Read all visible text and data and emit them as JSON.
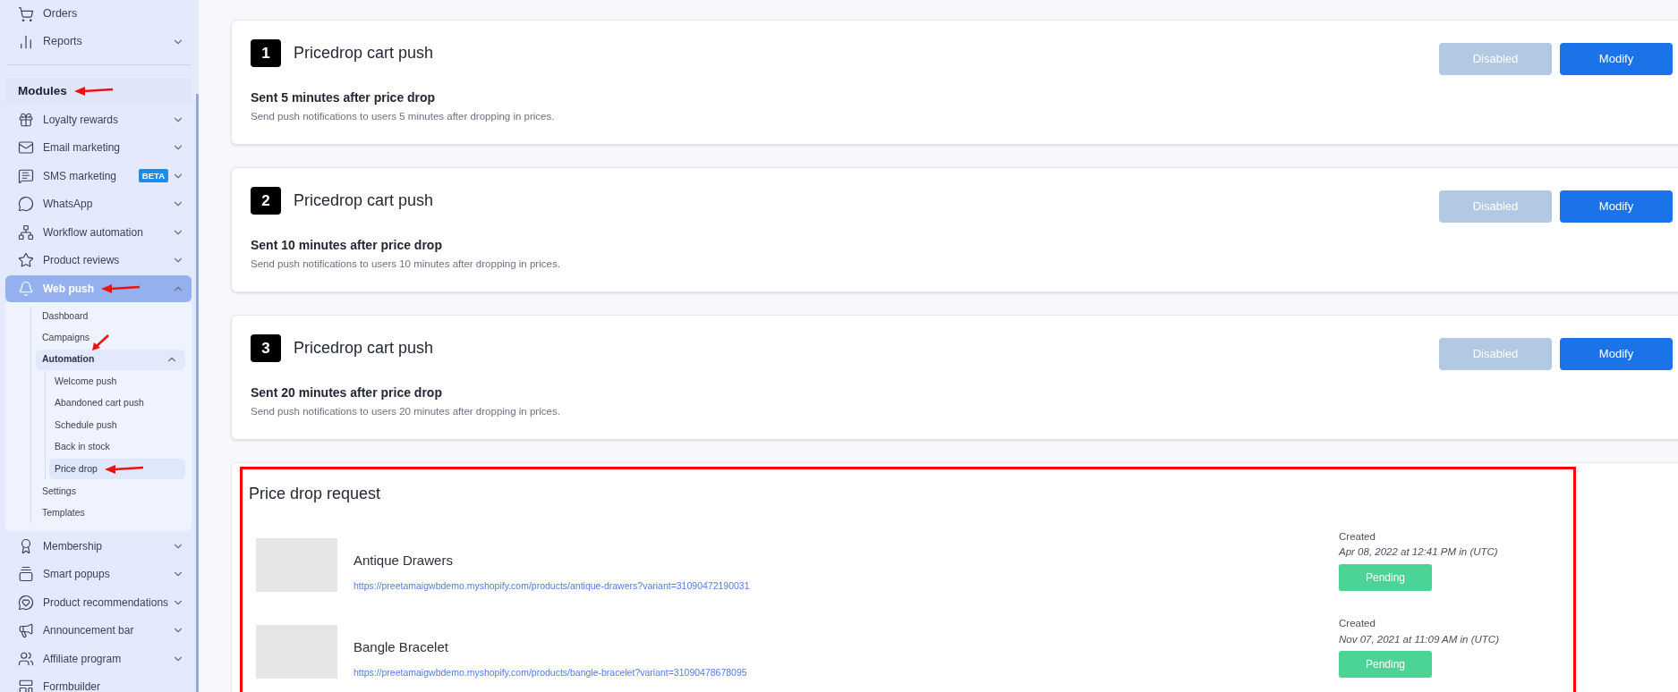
{
  "sidebar": {
    "items": [
      {
        "label": "Orders"
      },
      {
        "label": "Reports",
        "expanded": false
      }
    ],
    "section_title": "Modules",
    "modules": [
      {
        "label": "Loyalty rewards",
        "expanded": false,
        "selected": false
      },
      {
        "label": "Email marketing",
        "expanded": false,
        "selected": false
      },
      {
        "label": "SMS marketing",
        "badge": "BETA",
        "expanded": false,
        "selected": false
      },
      {
        "label": "WhatsApp",
        "expanded": false,
        "selected": false
      },
      {
        "label": "Workflow automation",
        "expanded": false,
        "selected": false
      },
      {
        "label": "Product reviews",
        "expanded": false,
        "selected": false
      },
      {
        "label": "Web push",
        "expanded": true,
        "selected": true,
        "children": [
          {
            "label": "Dashboard",
            "selected": false
          },
          {
            "label": "Campaigns",
            "selected": false
          },
          {
            "label": "Automation",
            "expanded": true,
            "children": [
              {
                "label": "Welcome push",
                "selected": false
              },
              {
                "label": "Abandoned cart push",
                "selected": false
              },
              {
                "label": "Schedule push",
                "selected": false
              },
              {
                "label": "Back in stock",
                "selected": false
              },
              {
                "label": "Price drop",
                "selected": true
              }
            ]
          },
          {
            "label": "Settings",
            "selected": false
          },
          {
            "label": "Templates",
            "selected": false
          }
        ]
      },
      {
        "label": "Membership",
        "expanded": false,
        "selected": false
      },
      {
        "label": "Smart popups",
        "expanded": false,
        "selected": false
      },
      {
        "label": "Product recommendations",
        "expanded": false,
        "selected": false
      },
      {
        "label": "Announcement bar",
        "expanded": false,
        "selected": false
      },
      {
        "label": "Affiliate program",
        "expanded": false,
        "selected": false
      },
      {
        "label": "Formbuilder",
        "selected": false
      }
    ]
  },
  "pushes": [
    {
      "number": "1",
      "title": "Pricedrop cart push",
      "subtitle": "Sent 5 minutes after price drop",
      "description": "Send push notifications to users 5 minutes after dropping in prices.",
      "status_button": "Disabled",
      "enabled": false,
      "action_button": "Modify"
    },
    {
      "number": "2",
      "title": "Pricedrop cart push",
      "subtitle": "Sent 10 minutes after price drop",
      "description": "Send push notifications to users 10 minutes after dropping in prices.",
      "status_button": "Disabled",
      "enabled": false,
      "action_button": "Modify"
    },
    {
      "number": "3",
      "title": "Pricedrop cart push",
      "subtitle": "Sent 20 minutes after price drop",
      "description": "Send push notifications to users 20 minutes after dropping in prices.",
      "status_button": "Disabled",
      "enabled": false,
      "action_button": "Modify"
    }
  ],
  "requests": {
    "title": "Price drop request",
    "rows": [
      {
        "product": "Antique Drawers",
        "url": "https://preetamaigwbdemo.myshopify.com/products/antique-drawers?variant=31090472190031",
        "created_label": "Created",
        "created": "Apr 08, 2022 at 12:41 PM in (UTC)",
        "status": "Pending"
      },
      {
        "product": "Bangle Bracelet",
        "url": "https://preetamaigwbdemo.myshopify.com/products/bangle-bracelet?variant=31090478678095",
        "created_label": "Created",
        "created": "Nov 07, 2021 at 11:09 AM in (UTC)",
        "status": "Pending"
      }
    ]
  }
}
